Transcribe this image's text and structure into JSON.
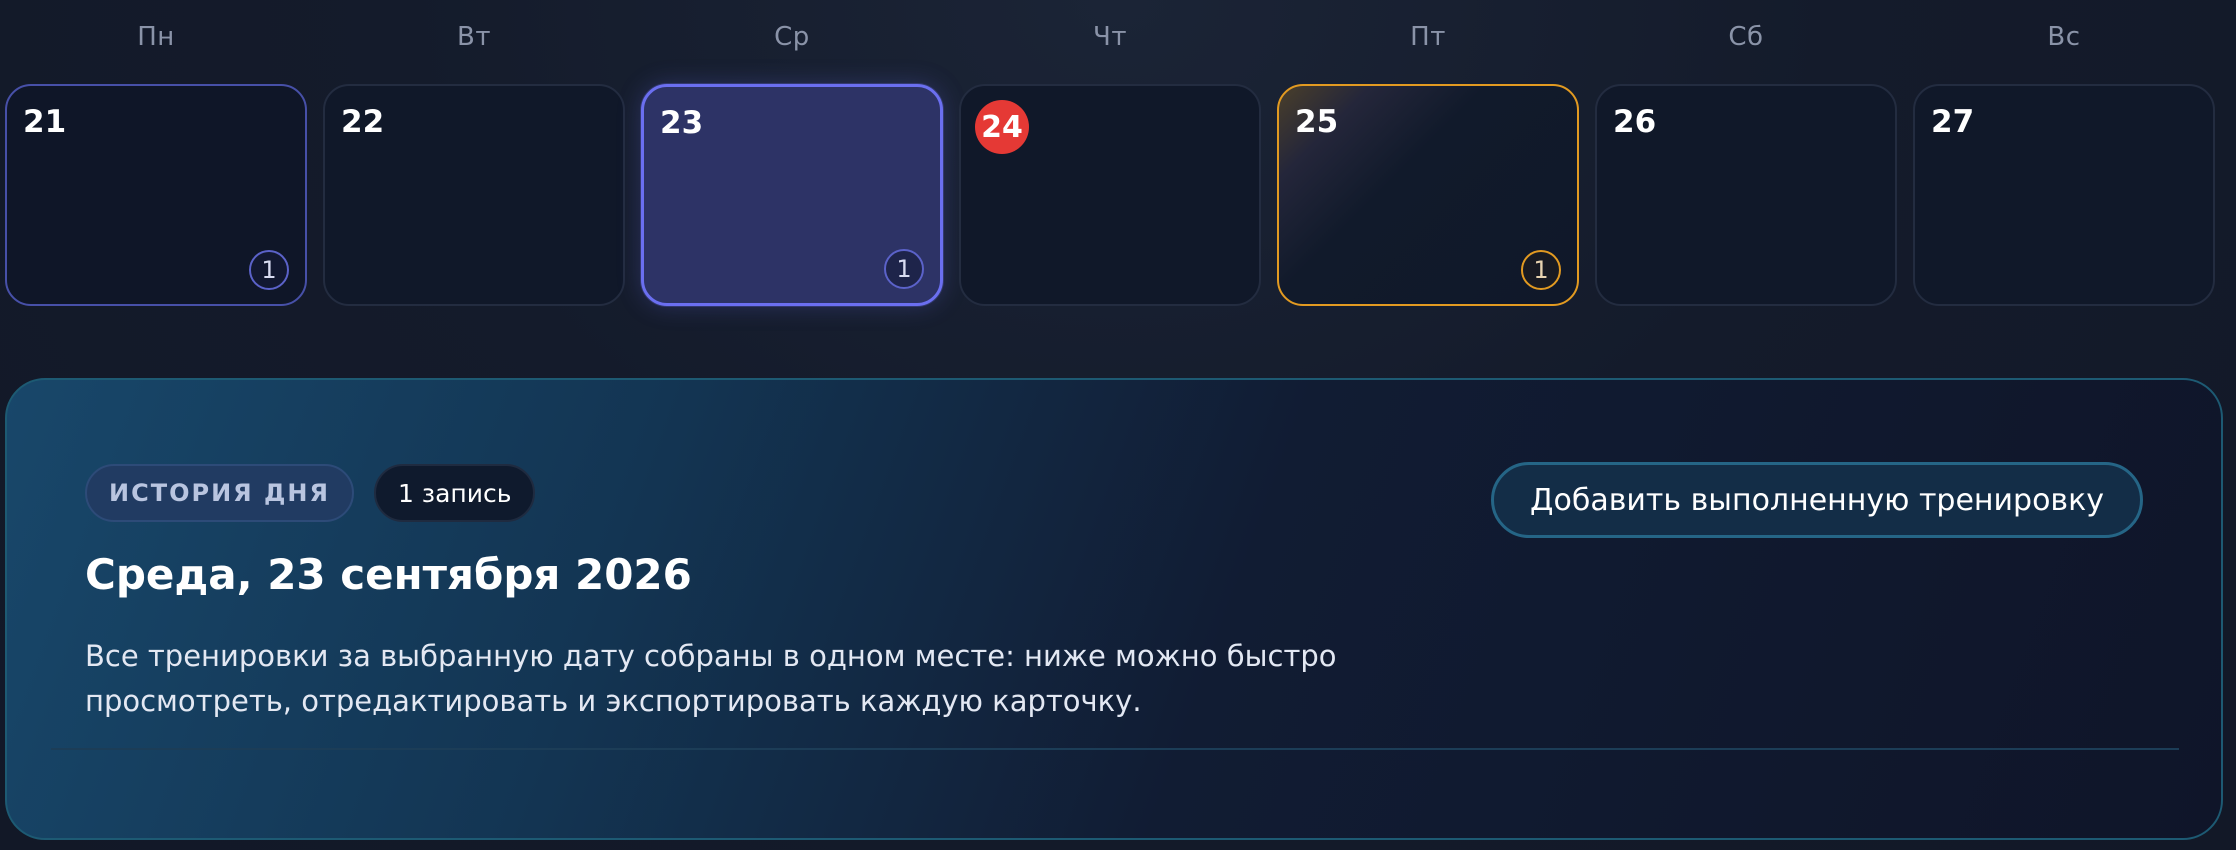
{
  "weekdays": [
    "Пн",
    "Вт",
    "Ср",
    "Чт",
    "Пт",
    "Сб",
    "Вс"
  ],
  "days": [
    {
      "num": "21",
      "count": "1",
      "state": "has-workout"
    },
    {
      "num": "22",
      "count": "",
      "state": "empty"
    },
    {
      "num": "23",
      "count": "1",
      "state": "selected"
    },
    {
      "num": "24",
      "count": "",
      "state": "today"
    },
    {
      "num": "25",
      "count": "1",
      "state": "highlight"
    },
    {
      "num": "26",
      "count": "",
      "state": "empty"
    },
    {
      "num": "27",
      "count": "",
      "state": "empty"
    }
  ],
  "history": {
    "tag_label": "ИСТОРИЯ ДНЯ",
    "count_label": "1 запись",
    "title": "Среда, 23 сентября 2026",
    "description": "Все тренировки за выбранную дату собраны в одном месте: ниже можно быстро просмотреть, отредактировать и экспортировать каждую карточку.",
    "add_button_label": "Добавить выполненную тренировку"
  },
  "colors": {
    "accent": "#6b6ff0",
    "today": "#e53935",
    "highlight": "#e29a21",
    "panel_border": "#1d5a73"
  }
}
